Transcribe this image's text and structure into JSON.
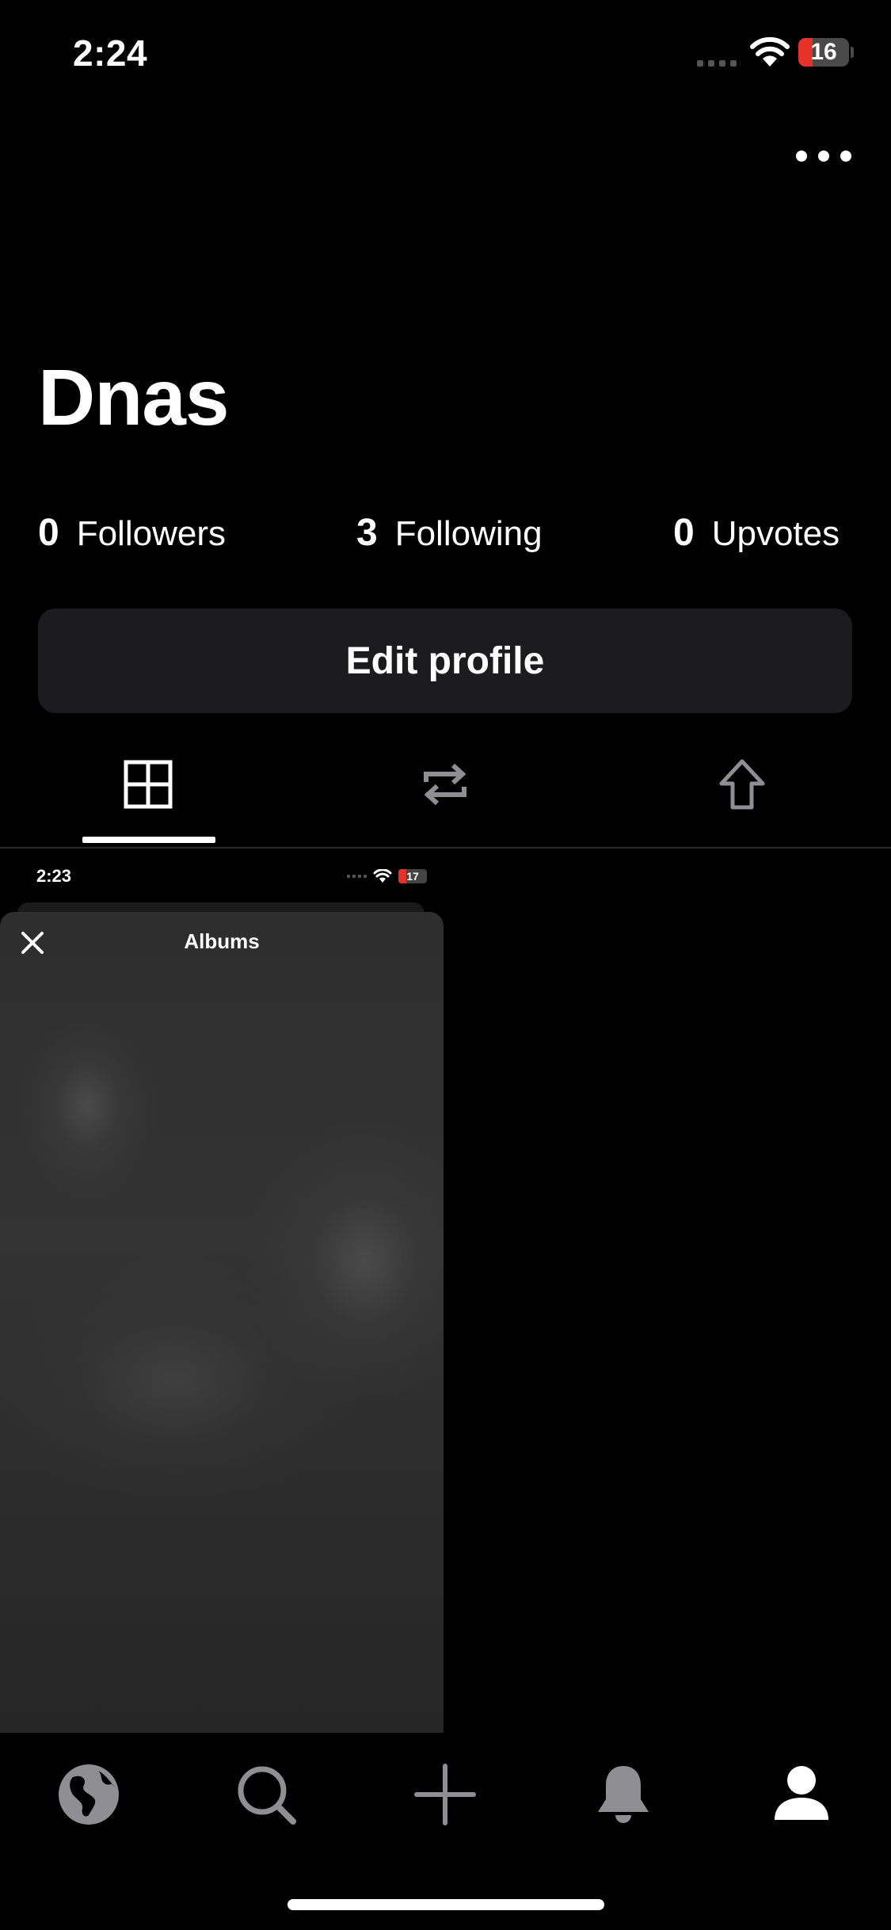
{
  "status_bar": {
    "time": "2:24",
    "battery": "16"
  },
  "profile": {
    "name": "Dnas",
    "stats": [
      {
        "value": "0",
        "label": "Followers"
      },
      {
        "value": "3",
        "label": "Following"
      },
      {
        "value": "0",
        "label": "Upvotes"
      }
    ],
    "edit_label": "Edit profile"
  },
  "tabs": [
    {
      "icon": "grid-icon",
      "selected": true
    },
    {
      "icon": "repost-icon",
      "selected": false
    },
    {
      "icon": "upvote-arrow-icon",
      "selected": false
    }
  ],
  "post": {
    "status_time": "2:23",
    "status_battery": "17",
    "sheet_title": "Albums"
  },
  "bottom_nav": [
    {
      "icon": "globe-icon",
      "active": false
    },
    {
      "icon": "search-icon",
      "active": false
    },
    {
      "icon": "plus-icon",
      "active": false
    },
    {
      "icon": "bell-icon",
      "active": false
    },
    {
      "icon": "profile-icon",
      "active": true
    }
  ],
  "colors": {
    "background": "#000000",
    "button": "#1c1c1e",
    "inactive_icon": "#8e8e93",
    "battery_low": "#e5332a"
  }
}
